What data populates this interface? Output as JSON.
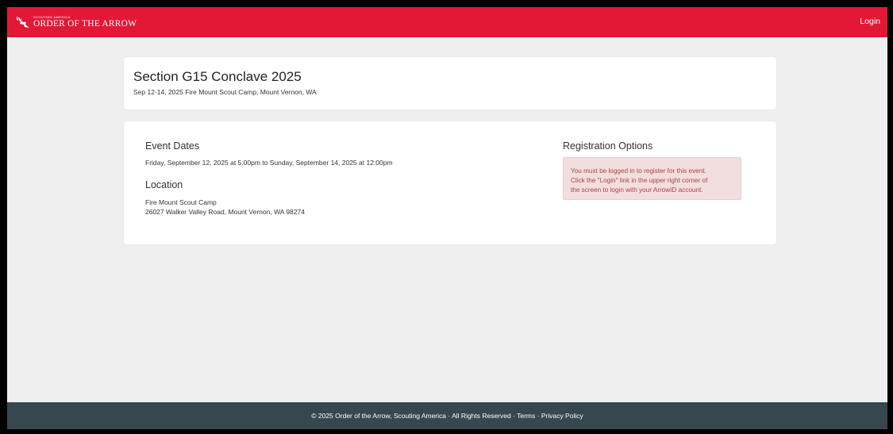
{
  "navbar": {
    "brand_small": "SCOUTING AMERICA",
    "brand_main": "ORDER OF THE ARROW",
    "login_label": "Login",
    "color": "#e31837"
  },
  "event": {
    "title": "Section G15 Conclave 2025",
    "subtitle": "Sep 12-14, 2025 Fire Mount Scout Camp, Mount Vernon, WA"
  },
  "details": {
    "dates_heading": "Event Dates",
    "dates_text": "Friday, September 12, 2025 at 5:00pm to Sunday, September 14, 2025 at 12:00pm",
    "location_heading": "Location",
    "location_name": "Fire Mount Scout Camp",
    "location_address": "26027 Walker Valley Road, Mount Vernon, WA 98274"
  },
  "registration": {
    "heading": "Registration Options",
    "alert_line1": "You must be logged in to register for this event.",
    "alert_line2": "Click the \"Login\" link in the upper right corner of",
    "alert_line3": "the screen to login with your ArrowID account."
  },
  "footer": {
    "copyright": "© 2025 Order of the Arrow, Scouting America · All Rights Reserved · ",
    "terms": "Terms",
    "separator": " · ",
    "privacy": "Privacy Policy",
    "color": "#37474f"
  }
}
